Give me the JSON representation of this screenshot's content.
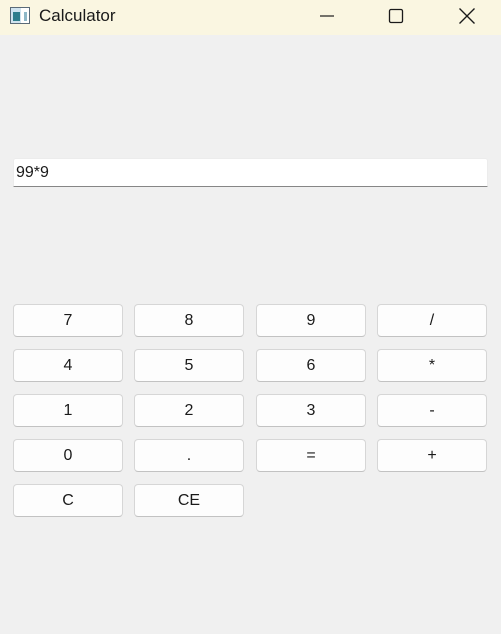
{
  "window": {
    "title": "Calculator",
    "controls": {
      "minimize_icon": "minimize-icon",
      "maximize_icon": "maximize-icon",
      "close_icon": "close-icon"
    }
  },
  "display": {
    "value": "99*9"
  },
  "keypad": {
    "rows": [
      [
        "7",
        "8",
        "9",
        "/"
      ],
      [
        "4",
        "5",
        "6",
        "*"
      ],
      [
        "1",
        "2",
        "3",
        "-"
      ],
      [
        "0",
        ".",
        "=",
        "+"
      ],
      [
        "C",
        "CE"
      ]
    ]
  },
  "colors": {
    "titlebar_bg": "#faf6e1",
    "window_bg": "#f0f0f0",
    "button_bg": "#fdfdfd",
    "button_border": "#d6d6d6"
  }
}
